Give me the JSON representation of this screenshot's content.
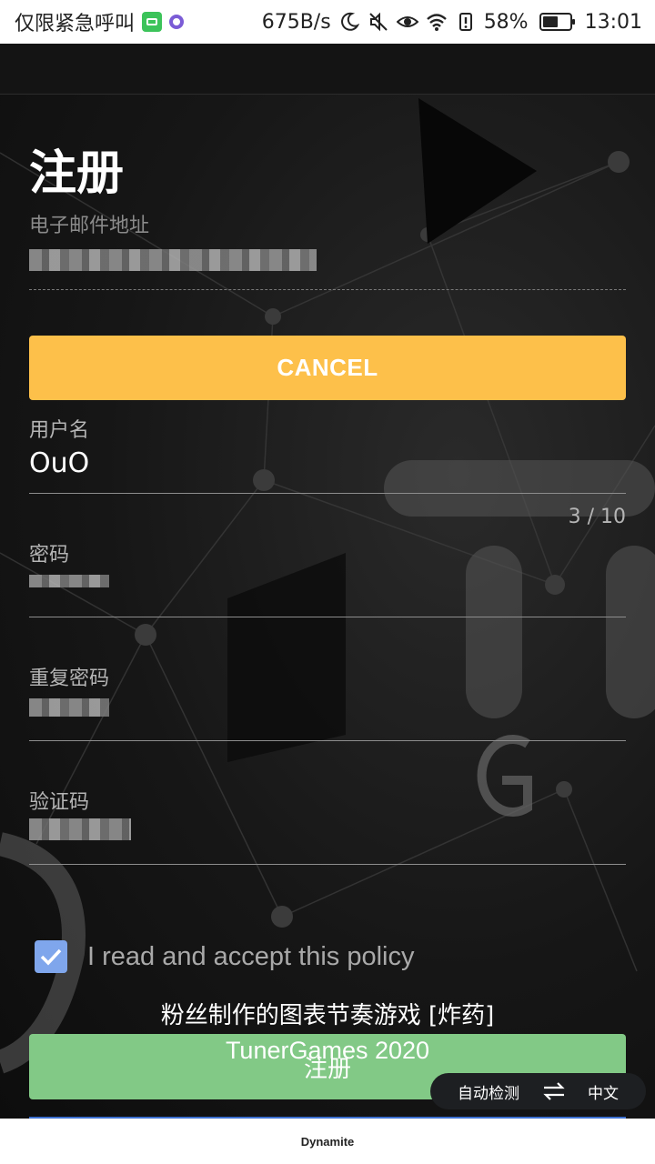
{
  "status_bar": {
    "carrier": "仅限紧急呼叫",
    "net_speed": "675B/s",
    "battery_percent": "58%",
    "battery_level": 0.58,
    "time": "13:01",
    "icons": [
      "iqiyi-app-icon",
      "app-dot-icon",
      "moon-icon",
      "mute-icon",
      "eye-icon",
      "wifi-icon",
      "battery-alert-icon",
      "battery-icon"
    ]
  },
  "form": {
    "title": "注册",
    "email": {
      "label": "电子邮件地址"
    },
    "cancel_label": "CANCEL",
    "username": {
      "label": "用户名",
      "value": "OuO",
      "counter": "3 / 10"
    },
    "password": {
      "label": "密码"
    },
    "repeat_password": {
      "label": "重复密码"
    },
    "captcha": {
      "label": "验证码"
    },
    "policy": {
      "text": "I read and accept this policy",
      "checked": true
    },
    "register_label": "注册"
  },
  "overlay": {
    "subtitle_line1": "粉丝制作的图表节奏游戏 [炸药]",
    "subtitle_line2": "TunerGames 2020",
    "translate_source": "自动检测",
    "translate_target": "中文"
  },
  "bottom_bar": {
    "title": "Dynamite"
  },
  "colors": {
    "cancel_button": "#fdc04a",
    "register_button": "#82c986",
    "checkbox": "#7fa6ec",
    "background": "#141414"
  }
}
